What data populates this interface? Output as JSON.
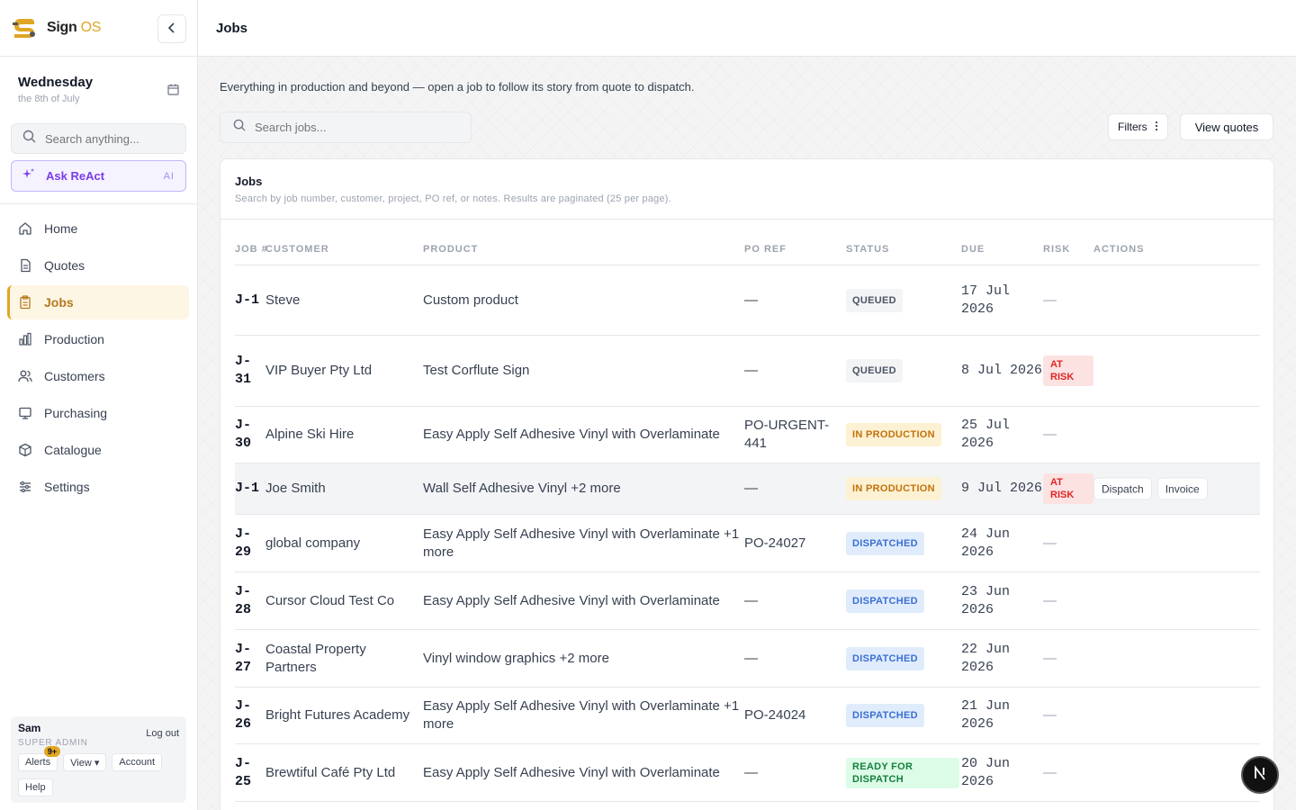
{
  "brand": {
    "name_main": "Sign",
    "name_accent": "OS"
  },
  "sidebar": {
    "day_name": "Wednesday",
    "day_sub": "the 8th of July",
    "search_placeholder": "Search anything...",
    "ask_label": "Ask ReAct",
    "ask_tag": "AI",
    "nav": [
      {
        "label": "Home",
        "icon": "home-icon"
      },
      {
        "label": "Quotes",
        "icon": "document-icon"
      },
      {
        "label": "Jobs",
        "icon": "clipboard-icon",
        "active": true
      },
      {
        "label": "Production",
        "icon": "bar-chart-icon"
      },
      {
        "label": "Customers",
        "icon": "users-icon"
      },
      {
        "label": "Purchasing",
        "icon": "receipt-icon"
      },
      {
        "label": "Catalogue",
        "icon": "box-icon"
      },
      {
        "label": "Settings",
        "icon": "sliders-icon"
      }
    ],
    "user": {
      "name": "Sam",
      "role": "SUPER ADMIN",
      "logout": "Log out",
      "alerts": "Alerts",
      "alerts_badge": "9+",
      "view": "View ▾",
      "account": "Account",
      "help": "Help"
    }
  },
  "topbar": {
    "title": "Jobs"
  },
  "main": {
    "intro": "Everything in production and beyond — open a job to follow its story from quote to dispatch.",
    "search_placeholder": "Search jobs...",
    "filters_label": "Filters",
    "view_quotes_label": "View quotes",
    "card_title": "Jobs",
    "card_sub": "Search by job number, customer, project, PO ref, or notes. Results are paginated (25 per page).",
    "columns": {
      "job": "JOB #",
      "customer": "CUSTOMER",
      "product": "PRODUCT",
      "po": "PO REF",
      "status": "STATUS",
      "due": "DUE",
      "risk": "RISK",
      "actions": "ACTIONS"
    },
    "rows": [
      {
        "job": "J-1",
        "customer": "Steve",
        "product": "Custom product",
        "po": "—",
        "status": "QUEUED",
        "due": "17 Jul 2026",
        "risk": "—"
      },
      {
        "job": "J-31",
        "customer": "VIP Buyer Pty Ltd",
        "product": "Test Corflute Sign",
        "po": "—",
        "status": "QUEUED",
        "due": "8 Jul 2026",
        "risk": "AT RISK"
      },
      {
        "job": "J-30",
        "customer": "Alpine Ski Hire",
        "product": "Easy Apply Self Adhesive Vinyl with Overlaminate",
        "po": "PO-URGENT-441",
        "status": "IN PRODUCTION",
        "due": "25 Jul 2026",
        "risk": "—"
      },
      {
        "job": "J-1",
        "customer": "Joe Smith",
        "product": "Wall Self Adhesive Vinyl +2 more",
        "po": "—",
        "status": "IN PRODUCTION",
        "due": "9 Jul 2026",
        "risk": "AT RISK",
        "actions": [
          "Dispatch",
          "Invoice"
        ]
      },
      {
        "job": "J-29",
        "customer": "global company",
        "product": "Easy Apply Self Adhesive Vinyl with Overlaminate +1 more",
        "po": "PO-24027",
        "status": "DISPATCHED",
        "due": "24 Jun 2026",
        "risk": "—"
      },
      {
        "job": "J-28",
        "customer": "Cursor Cloud Test Co",
        "product": "Easy Apply Self Adhesive Vinyl with Overlaminate",
        "po": "—",
        "status": "DISPATCHED",
        "due": "23 Jun 2026",
        "risk": "—"
      },
      {
        "job": "J-27",
        "customer": "Coastal Property Partners",
        "product": "Vinyl window graphics +2 more",
        "po": "—",
        "status": "DISPATCHED",
        "due": "22 Jun 2026",
        "risk": "—"
      },
      {
        "job": "J-26",
        "customer": "Bright Futures Academy",
        "product": "Easy Apply Self Adhesive Vinyl with Overlaminate +1 more",
        "po": "PO-24024",
        "status": "DISPATCHED",
        "due": "21 Jun 2026",
        "risk": "—"
      },
      {
        "job": "J-25",
        "customer": "Brewtiful Café Pty Ltd",
        "product": "Easy Apply Self Adhesive Vinyl with Overlaminate",
        "po": "—",
        "status": "READY FOR DISPATCH",
        "due": "20 Jun 2026",
        "risk": "—"
      }
    ]
  },
  "colors": {
    "accent": "#e0a624",
    "ai": "#7c3aed",
    "risk": "#dc2626"
  }
}
